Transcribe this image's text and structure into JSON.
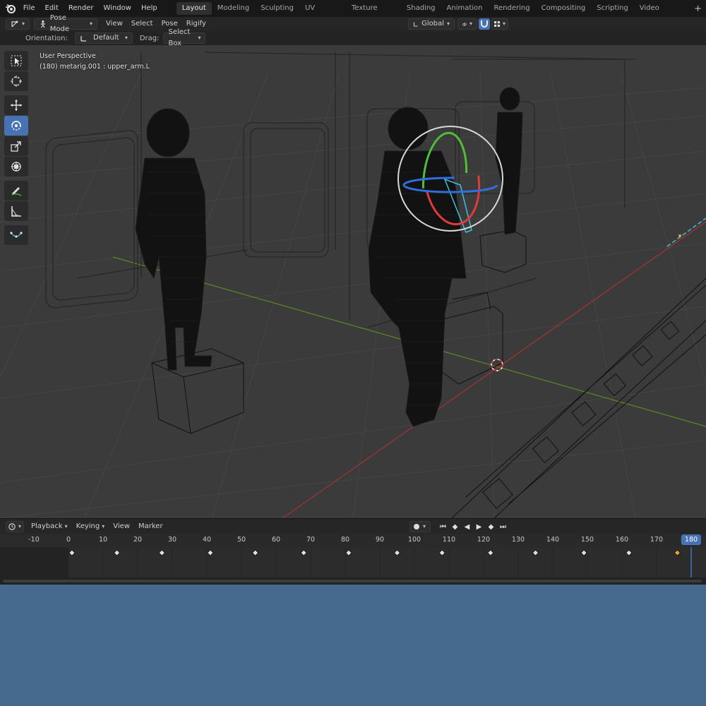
{
  "menu": [
    "File",
    "Edit",
    "Render",
    "Window",
    "Help"
  ],
  "workspaces": [
    "Layout",
    "Modeling",
    "Sculpting",
    "UV Editing",
    "Texture Paint",
    "Shading",
    "Animation",
    "Rendering",
    "Compositing",
    "Scripting",
    "Video Editing"
  ],
  "active_workspace": "Layout",
  "add_workspace": "+",
  "header": {
    "mode": "Pose Mode",
    "view": "View",
    "select": "Select",
    "pose": "Pose",
    "rigify": "Rigify",
    "orientation_value": "Global"
  },
  "tool_settings": {
    "orientation_label": "Orientation:",
    "orientation_value": "Default",
    "drag_label": "Drag:",
    "drag_value": "Select Box"
  },
  "viewport_info": {
    "line1": "User Perspective",
    "line2": "(180) metarig.001 : upper_arm.L"
  },
  "toolbar": [
    "select-box",
    "cursor",
    "move",
    "rotate",
    "scale",
    "transform",
    "annotate",
    "measure",
    "bone-tool"
  ],
  "active_tool": "rotate",
  "timeline": {
    "playback": "Playback",
    "keying": "Keying",
    "view": "View",
    "marker": "Marker",
    "ticks": [
      "-10",
      "0",
      "10",
      "20",
      "30",
      "40",
      "50",
      "60",
      "70",
      "80",
      "90",
      "100",
      "110",
      "120",
      "130",
      "140",
      "150",
      "160",
      "170"
    ],
    "current_frame": "180",
    "keyframes": [
      1,
      14,
      27,
      41,
      54,
      68,
      81,
      95,
      108,
      122,
      135,
      149,
      162,
      176
    ]
  },
  "colors": {
    "accent": "#4772b3",
    "x_axis": "#a83232",
    "y_axis": "#5a8a1e",
    "gizmo_red": "#e03a3a",
    "gizmo_green": "#4fbf3a",
    "gizmo_blue": "#2f6fe0",
    "bone_selected": "#40c0e0",
    "keyframe_selected": "#f0a030",
    "background": "#466a8d"
  }
}
